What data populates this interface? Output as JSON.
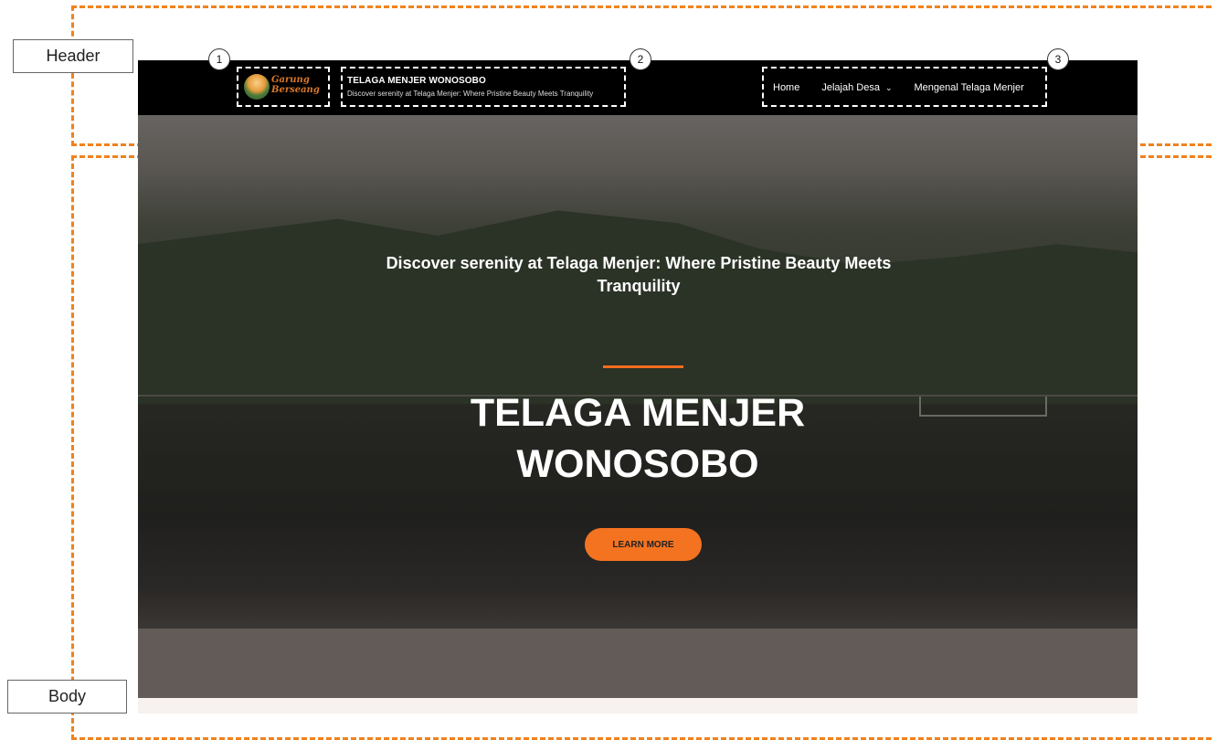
{
  "annotations": {
    "header_label": "Header",
    "body_label": "Body",
    "callouts": [
      "1",
      "2",
      "3"
    ],
    "accent_color": "#f0821e"
  },
  "site": {
    "logo": {
      "line1": "Garung",
      "line2": "Berseang"
    },
    "title": "TELAGA MENJER WONOSOBO",
    "tagline": "Discover serenity at Telaga Menjer: Where Pristine Beauty Meets Tranquility",
    "nav": [
      {
        "label": "Home"
      },
      {
        "label": "Jelajah Desa",
        "has_dropdown": true
      },
      {
        "label": "Mengenal Telaga Menjer"
      }
    ]
  },
  "hero": {
    "subtitle": "Discover serenity at Telaga Menjer: Where Pristine Beauty Meets Tranquility",
    "title": "TELAGA MENJER WONOSOBO",
    "cta_label": "LEARN MORE",
    "cta_color": "#f47320",
    "divider_color": "#f26d1f"
  }
}
